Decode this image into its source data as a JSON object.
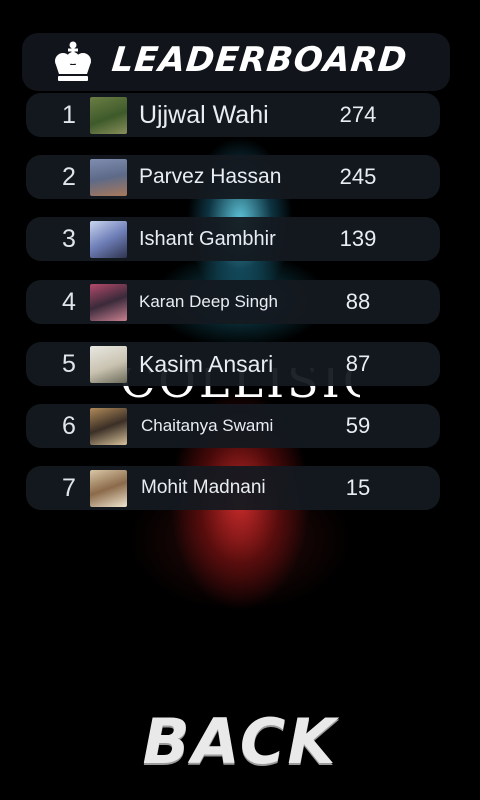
{
  "header": {
    "title": "LEADERBOARD",
    "icon": "crown-icon"
  },
  "background": {
    "word": "COLLISION",
    "glow_top": "#6ee6ff",
    "glow_bottom": "#eb3232"
  },
  "rows": [
    {
      "rank": "1",
      "name": "Ujjwal Wahi",
      "score": "274"
    },
    {
      "rank": "2",
      "name": "Parvez Hassan",
      "score": "245"
    },
    {
      "rank": "3",
      "name": "Ishant Gambhir",
      "score": "139"
    },
    {
      "rank": "4",
      "name": "Karan Deep Singh",
      "score": "88"
    },
    {
      "rank": "5",
      "name": "Kasim Ansari",
      "score": "87"
    },
    {
      "rank": "6",
      "name": "Chaitanya Swami",
      "score": "59"
    },
    {
      "rank": "7",
      "name": "Mohit Madnani",
      "score": "15"
    }
  ],
  "back_label": "BACK"
}
